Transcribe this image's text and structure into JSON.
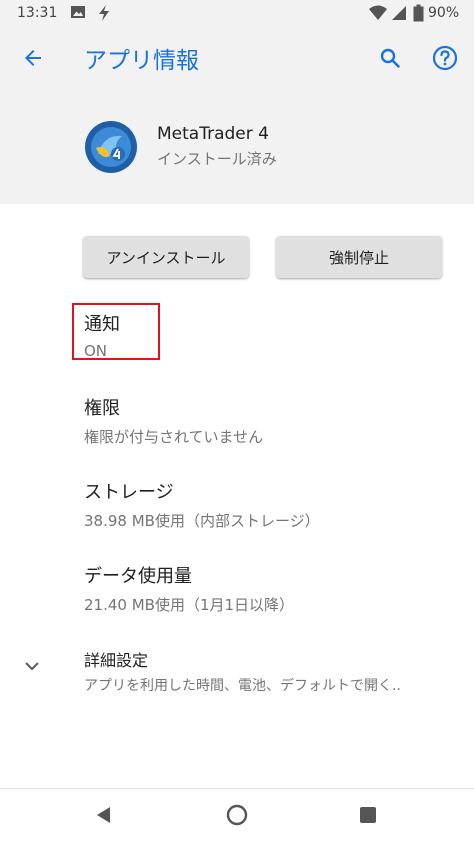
{
  "status_bar": {
    "time": "13:31",
    "battery": "90%"
  },
  "app_bar": {
    "title": "アプリ情報"
  },
  "app": {
    "name": "MetaTrader 4",
    "status": "インストール済み"
  },
  "buttons": {
    "uninstall": "アンインストール",
    "force_stop": "強制停止"
  },
  "items": [
    {
      "title": "通知",
      "subtitle": "ON"
    },
    {
      "title": "権限",
      "subtitle": "権限が付与されていません"
    },
    {
      "title": "ストレージ",
      "subtitle": "38.98 MB使用（内部ストレージ）"
    },
    {
      "title": "データ使用量",
      "subtitle": "21.40 MB使用（1月1日以降）"
    },
    {
      "title": "詳細設定",
      "subtitle": "アプリを利用した時間、電池、デフォルトで開く.."
    }
  ],
  "colors": {
    "accent": "#1a73d9",
    "highlight": "#e0141e",
    "header_bg": "#f2f2f2"
  },
  "icons": [
    "back-icon",
    "search-icon",
    "help-icon",
    "expand-icon",
    "nav-back-icon",
    "nav-home-icon",
    "nav-recents-icon"
  ]
}
